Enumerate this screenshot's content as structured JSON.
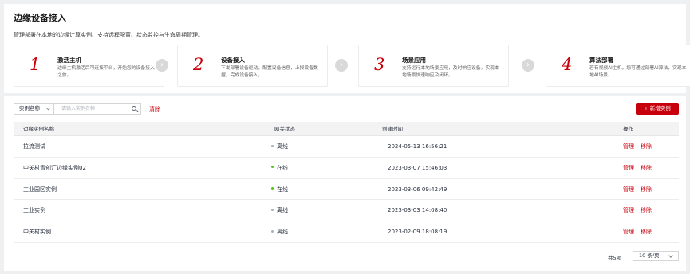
{
  "header": {
    "title": "边缘设备接入",
    "description": "管理部署在本地的边缘计算实例、支持远程配置、状态监控与生命周期管理。"
  },
  "steps": [
    {
      "number": "1",
      "title": "激活主机",
      "text": "边缘主机激活后可连接平台，开始您的设备接入之旅。"
    },
    {
      "number": "2",
      "title": "设备接入",
      "text": "下发部署设备驱动，配置设备信息，上报设备数据，完成设备接入。"
    },
    {
      "number": "3",
      "title": "场景应用",
      "text": "支持运行本地场景应用，及时响应设备，实现本地场景快速响应及闭环。"
    },
    {
      "number": "4",
      "title": "算法部署",
      "text": "若有视频AI主机，您可通过部署AI算法，实现本地AI场景。"
    }
  ],
  "toolbar": {
    "filter_field": "实例名称",
    "search_placeholder": "请输入实例名称",
    "clear_label": "清除",
    "add_label": "+ 新增实例"
  },
  "table": {
    "columns": [
      "边缘实例名称",
      "网关状态",
      "创建时间",
      "操作"
    ],
    "rows": [
      {
        "name": "拉流测试",
        "status": "离线",
        "status_color": "#adb0b8",
        "created": "2024-05-13 16:56:21",
        "manage": "管理",
        "remove": "移除"
      },
      {
        "name": "中关村青创汇边缘实例02",
        "status": "在线",
        "status_color": "#52c41a",
        "created": "2023-03-07 15:46:03",
        "manage": "管理",
        "remove": "移除"
      },
      {
        "name": "工业园区实例",
        "status": "在线",
        "status_color": "#52c41a",
        "created": "2023-03-06 09:42:49",
        "manage": "管理",
        "remove": "移除"
      },
      {
        "name": "工业实例",
        "status": "离线",
        "status_color": "#adb0b8",
        "created": "2023-03-03 14:08:40",
        "manage": "管理",
        "remove": "移除"
      },
      {
        "name": "中关村实例",
        "status": "离线",
        "status_color": "#adb0b8",
        "created": "2023-02-09 18:08:19",
        "manage": "管理",
        "remove": "移除"
      }
    ]
  },
  "pagination": {
    "total": "共5项",
    "page_size": "10 条/页"
  },
  "icons": {
    "step_arrow": "chevron-right-icon",
    "search": "search-icon",
    "dropdown": "chevron-down-icon"
  },
  "colors": {
    "brand": "#c7000b",
    "online": "#52c41a",
    "offline": "#adb0b8"
  }
}
